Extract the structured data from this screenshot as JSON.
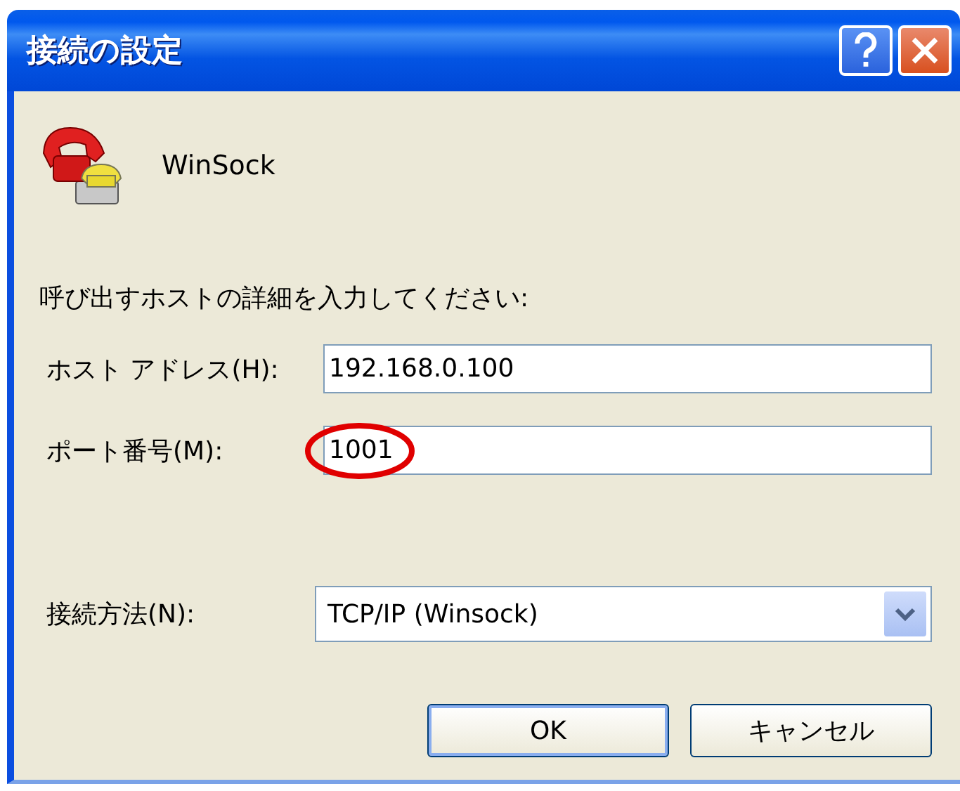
{
  "window": {
    "title": "接続の設定"
  },
  "connection": {
    "name": "WinSock"
  },
  "prompt": "呼び出すホストの詳細を入力してください:",
  "fields": [
    {
      "label": "ホスト アドレス(H):",
      "value": "192.168.0.100",
      "highlighted": false
    },
    {
      "label": "ポート番号(M):",
      "value": "1001",
      "highlighted": true
    }
  ],
  "method": {
    "label": "接続方法(N):",
    "value": "TCP/IP (Winsock)"
  },
  "buttons": [
    {
      "label": "OK",
      "default": true
    },
    {
      "label": "キャンセル",
      "default": false
    }
  ]
}
